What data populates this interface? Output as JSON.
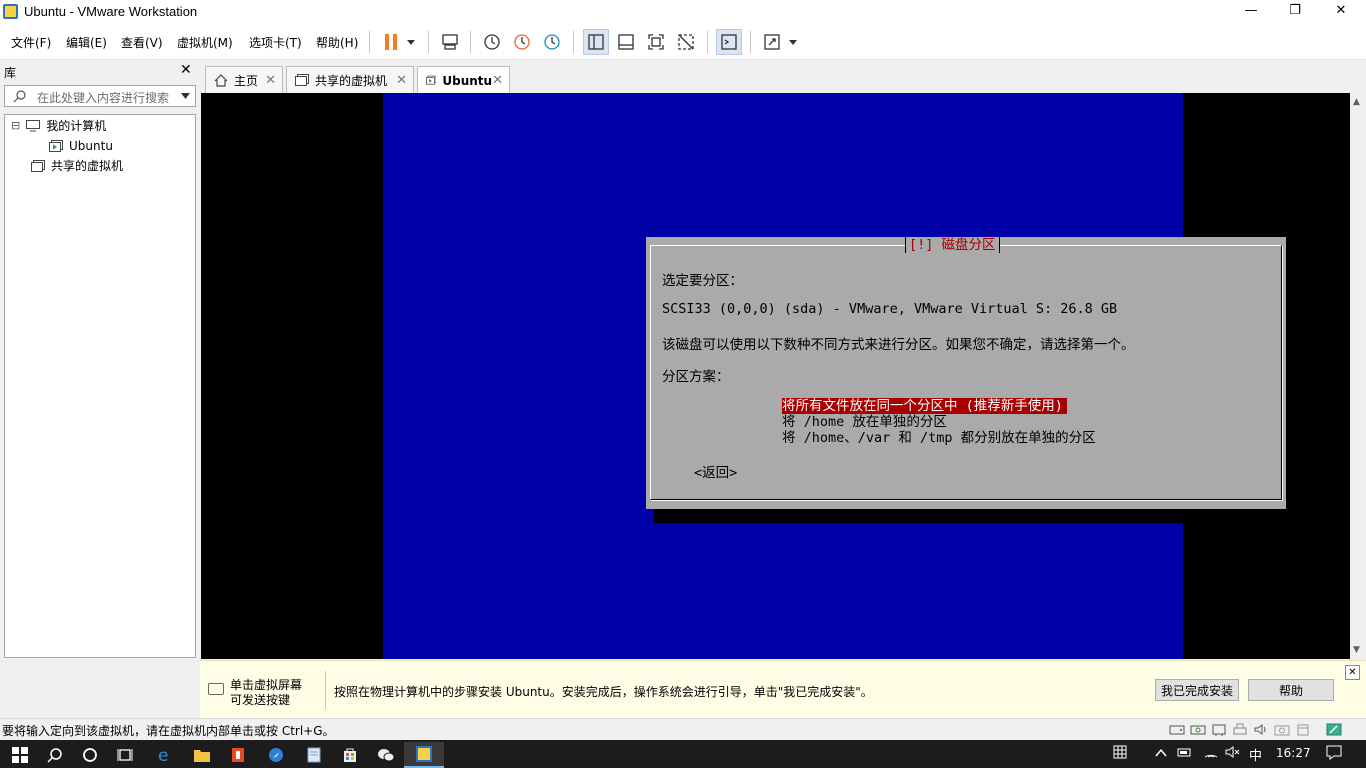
{
  "window": {
    "title": "Ubuntu - VMware Workstation",
    "minimize": "—",
    "maximize": "❐",
    "close": "✕"
  },
  "menu": [
    "文件(F)",
    "编辑(E)",
    "查看(V)",
    "虚拟机(M)",
    "选项卡(T)",
    "帮助(H)"
  ],
  "toolbar": {
    "icons": [
      "pause-icon",
      "dropdown-arrow-icon",
      "send-ctrl-alt-del-icon",
      "snapshot-icon",
      "revert-snapshot-icon",
      "snapshot-manager-icon",
      "show-library-icon",
      "thumbnail-bar-icon",
      "fullscreen-icon",
      "unity-icon",
      "console-view-icon",
      "stretch-guest-icon",
      "dropdown-arrow-icon"
    ],
    "pause_color": "#f47a20"
  },
  "library": {
    "header": "库",
    "close": "✕",
    "search_placeholder": "在此处键入内容进行搜索",
    "tree": [
      {
        "label": "我的计算机",
        "expander": "⊟"
      },
      {
        "label": "Ubuntu"
      },
      {
        "label": "共享的虚拟机"
      }
    ]
  },
  "tabs": [
    {
      "label": "主页",
      "close": "✕"
    },
    {
      "label": "共享的虚拟机",
      "close": "✕"
    },
    {
      "label": "Ubuntu",
      "close": "✕"
    }
  ],
  "installer": {
    "title": "[!] 磁盘分区",
    "prompt": "选定要分区：",
    "disk": "SCSI33 (0,0,0) (sda) - VMware, VMware Virtual S: 26.8 GB",
    "description": "该磁盘可以使用以下数种不同方式来进行分区。如果您不确定，请选择第一个。",
    "scheme_label": "分区方案：",
    "options": [
      "将所有文件放在同一个分区中 (推荐新手使用)",
      "将 /home 放在单独的分区",
      "将 /home、/var 和 /tmp 都分别放在单独的分区"
    ],
    "selected_index": 0,
    "back": "<返回>",
    "colors": {
      "background": "#0000a8",
      "dialog": "#aaaaaa",
      "highlight": "#a80000"
    }
  },
  "hint": {
    "left_line1": "单击虚拟屏幕",
    "left_line2": "可发送按键",
    "message": "按照在物理计算机中的步骤安装 Ubuntu。安装完成后，操作系统会进行引导，单击\"我已完成安装\"。",
    "done_button": "我已完成安装",
    "help_button": "帮助",
    "close": "✕"
  },
  "status": {
    "text": "要将输入定向到该虚拟机，请在虚拟机内部单击或按 Ctrl+G。"
  },
  "taskbar": {
    "apps": [
      "windows-start-icon",
      "search-icon",
      "cortana-icon",
      "task-view-icon",
      "edge-icon",
      "file-explorer-icon",
      "office-icon",
      "app-icon",
      "notepad-icon",
      "store-icon",
      "wechat-icon",
      "vmware-icon"
    ],
    "ime": "中",
    "time": "16:27"
  }
}
